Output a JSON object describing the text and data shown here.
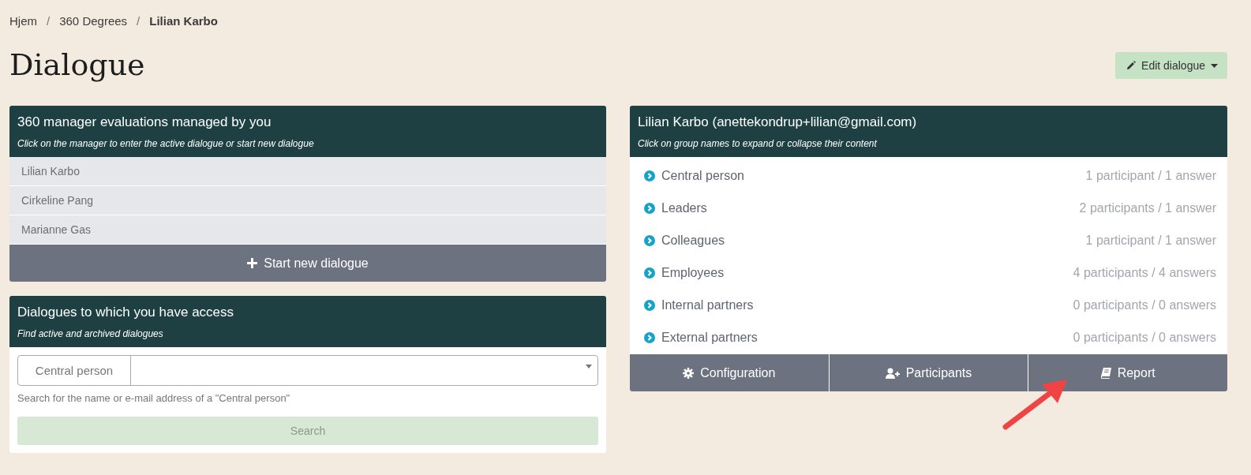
{
  "breadcrumb_separator": "/",
  "breadcrumb": [
    {
      "label": "Hjem",
      "current": false
    },
    {
      "label": "360 Degrees",
      "current": false
    },
    {
      "label": "Lilian Karbo",
      "current": true
    }
  ],
  "page_title": "Dialogue",
  "edit_button": {
    "label": "Edit dialogue"
  },
  "managed_card": {
    "title": "360 manager evaluations managed by you",
    "subtitle": "Click on the manager to enter the active dialogue or start new dialogue",
    "items": [
      "Lilian Karbo",
      "Cirkeline Pang",
      "Marianne Gas"
    ],
    "button": "Start new dialogue"
  },
  "access_card": {
    "title": "Dialogues to which you have access",
    "subtitle": "Find active and archived dialogues",
    "field_label": "Central person",
    "help": "Search for the name or e-mail address of a \"Central person\"",
    "button": {
      "label": "Search",
      "disabled": true
    }
  },
  "person_card": {
    "title": "Lilian Karbo (anettekondrup+lilian@gmail.com)",
    "subtitle": "Click on group names to expand or collapse their content",
    "groups": [
      {
        "name": "Central person",
        "count": "1 participant / 1 answer",
        "expanded": false
      },
      {
        "name": "Leaders",
        "count": "2 participants / 1 answer",
        "expanded": false
      },
      {
        "name": "Colleagues",
        "count": "1 participant / 1 answer",
        "expanded": false
      },
      {
        "name": "Employees",
        "count": "4 participants / 4 answers",
        "expanded": false
      },
      {
        "name": "Internal partners",
        "count": "0 participants / 0 answers",
        "expanded": false
      },
      {
        "name": "External partners",
        "count": "0 participants / 0 answers",
        "expanded": false
      }
    ],
    "actions": [
      "Configuration",
      "Participants",
      "Report"
    ]
  }
}
